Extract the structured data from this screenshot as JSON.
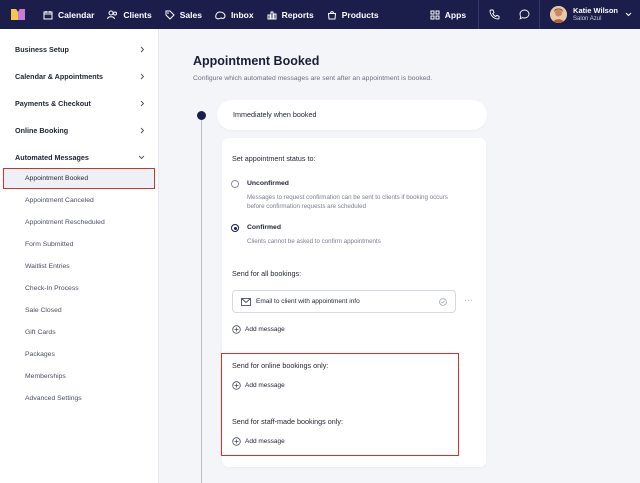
{
  "nav": {
    "items": [
      {
        "label": "Calendar",
        "icon": "calendar-icon"
      },
      {
        "label": "Clients",
        "icon": "users-icon"
      },
      {
        "label": "Sales",
        "icon": "tag-icon"
      },
      {
        "label": "Inbox",
        "icon": "inbox-icon"
      },
      {
        "label": "Reports",
        "icon": "chart-icon"
      },
      {
        "label": "Products",
        "icon": "bag-icon"
      }
    ],
    "apps_label": "Apps",
    "user": {
      "name": "Katie Wilson",
      "org": "Salon Azul"
    }
  },
  "sidebar": {
    "sections": [
      {
        "label": "Business Setup"
      },
      {
        "label": "Calendar & Appointments"
      },
      {
        "label": "Payments & Checkout"
      },
      {
        "label": "Online Booking"
      },
      {
        "label": "Automated Messages"
      }
    ],
    "sub_items": [
      {
        "label": "Appointment Booked"
      },
      {
        "label": "Appointment Canceled"
      },
      {
        "label": "Appointment Rescheduled"
      },
      {
        "label": "Form Submitted"
      },
      {
        "label": "Waitlist Entries"
      },
      {
        "label": "Check-In Process"
      },
      {
        "label": "Sale Closed"
      },
      {
        "label": "Gift Cards"
      },
      {
        "label": "Packages"
      },
      {
        "label": "Memberships"
      },
      {
        "label": "Advanced Settings"
      }
    ]
  },
  "main": {
    "title": "Appointment Booked",
    "subtitle": "Configure which automated messages are sent after an appointment is booked.",
    "trigger_label": "Immediately when booked",
    "status_label": "Set appointment status to:",
    "options": [
      {
        "title": "Unconfirmed",
        "desc": "Messages to request confirmation can be sent to clients if booking occurs before confirmation requests are scheduled",
        "selected": false
      },
      {
        "title": "Confirmed",
        "desc": "Clients cannot be asked to confirm appointments",
        "selected": true
      }
    ],
    "all_bookings_label": "Send for all bookings:",
    "message_item": "Email to client with appointment info",
    "more": "···",
    "add_message": "Add message",
    "online_label": "Send for online bookings only:",
    "staff_label": "Send for staff-made bookings only:"
  },
  "colors": {
    "nav_bg": "#1b1e4b",
    "highlight": "#d93025",
    "page_bg": "#f4f5f8"
  }
}
